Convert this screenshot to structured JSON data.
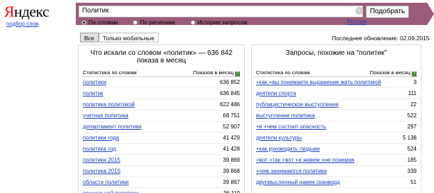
{
  "logo": {
    "first": "Я",
    "rest": "ндекс"
  },
  "wordstat_link": "подбор слов",
  "search": {
    "value": "Политик",
    "clear_glyph": "×",
    "button": "Подобрать"
  },
  "modes": [
    {
      "label": "По словам",
      "selected": true
    },
    {
      "label": "По регионам",
      "selected": false
    },
    {
      "label": "История запросов",
      "selected": false
    }
  ],
  "region": "Россия",
  "tabs": [
    "Все",
    "Только мобильные"
  ],
  "last_update": "Последнее обновление: 02.09.2015",
  "left": {
    "title": "Что искали со словом «политик» — 636 842 показа в месяц",
    "col_stats": "Статистика по словам",
    "col_shows": "Показов в месяц",
    "help": "?",
    "rows": [
      {
        "phrase": "политики",
        "count": "636 852"
      },
      {
        "phrase": "политик",
        "count": "636 845"
      },
      {
        "phrase": "политика политикой",
        "count": "622 486"
      },
      {
        "phrase": "учетная политика",
        "count": "68 751"
      },
      {
        "phrase": "департамент политики",
        "count": "52 907"
      },
      {
        "phrase": "политики года",
        "count": "41 429"
      },
      {
        "phrase": "политика год",
        "count": "41 428"
      },
      {
        "phrase": "политики 2015",
        "count": "39 869"
      },
      {
        "phrase": "политика 2015",
        "count": "39 868"
      },
      {
        "phrase": "области политики",
        "count": "39 867"
      },
      {
        "phrase": "социальной политики",
        "count": "36 119"
      }
    ]
  },
  "right": {
    "title": "Запросы, похожие на \"политик\"",
    "col_stats": "Статистика по словам",
    "col_shows": "Показов в месяц",
    "help": "?",
    "rows": [
      {
        "phrase": "+как +вы понимаете выражение жить политикой",
        "count": "3"
      },
      {
        "phrase": "деятели спорта",
        "count": "111"
      },
      {
        "phrase": "публицистическое выступление",
        "count": "22"
      },
      {
        "phrase": "выступление политика",
        "count": "522"
      },
      {
        "phrase": "+в +чем состоит опасность",
        "count": "297"
      },
      {
        "phrase": "деятели культуры",
        "count": "5 138"
      },
      {
        "phrase": "+как руководить людьми",
        "count": "524"
      },
      {
        "phrase": "+вот +так +вот +и живем +не понимая",
        "count": "185"
      },
      {
        "phrase": "+чем занимаются политики",
        "count": "339"
      },
      {
        "phrase": "двусмысленный намек сканворд",
        "count": "51"
      }
    ]
  }
}
